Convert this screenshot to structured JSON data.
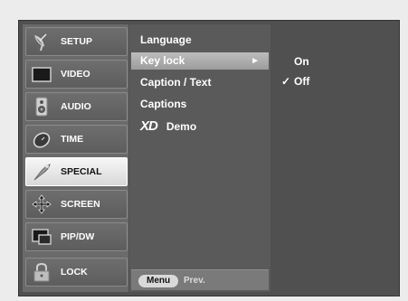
{
  "sidebar": {
    "items": [
      {
        "label": "SETUP",
        "icon": "satellite-dish-icon"
      },
      {
        "label": "VIDEO",
        "icon": "monitor-icon"
      },
      {
        "label": "AUDIO",
        "icon": "speaker-icon"
      },
      {
        "label": "TIME",
        "icon": "clock-icon"
      },
      {
        "label": "SPECIAL",
        "icon": "special-icon"
      },
      {
        "label": "SCREEN",
        "icon": "move-arrows-icon"
      },
      {
        "label": "PIP/DW",
        "icon": "pip-icon"
      },
      {
        "label": "LOCK",
        "icon": "padlock-icon"
      }
    ],
    "active_index": 4
  },
  "submenu": {
    "items": [
      {
        "label": "Language"
      },
      {
        "label": "Key lock",
        "arrow": "►"
      },
      {
        "label": "Caption / Text"
      },
      {
        "label": "Captions"
      },
      {
        "logo": "XD",
        "label": "Demo"
      }
    ],
    "highlighted_index": 1,
    "footer": {
      "menu_label": "Menu",
      "prev_label": "Prev."
    }
  },
  "options": {
    "items": [
      {
        "label": "On",
        "checked": false,
        "check": ""
      },
      {
        "label": "Off",
        "checked": true,
        "check": "✓"
      }
    ]
  },
  "colors": {
    "screen_bg": "#505050",
    "sidebar_bg": "#6a6a6a",
    "highlight": "#bdbdbd",
    "active_item": "#f0f0f0"
  }
}
